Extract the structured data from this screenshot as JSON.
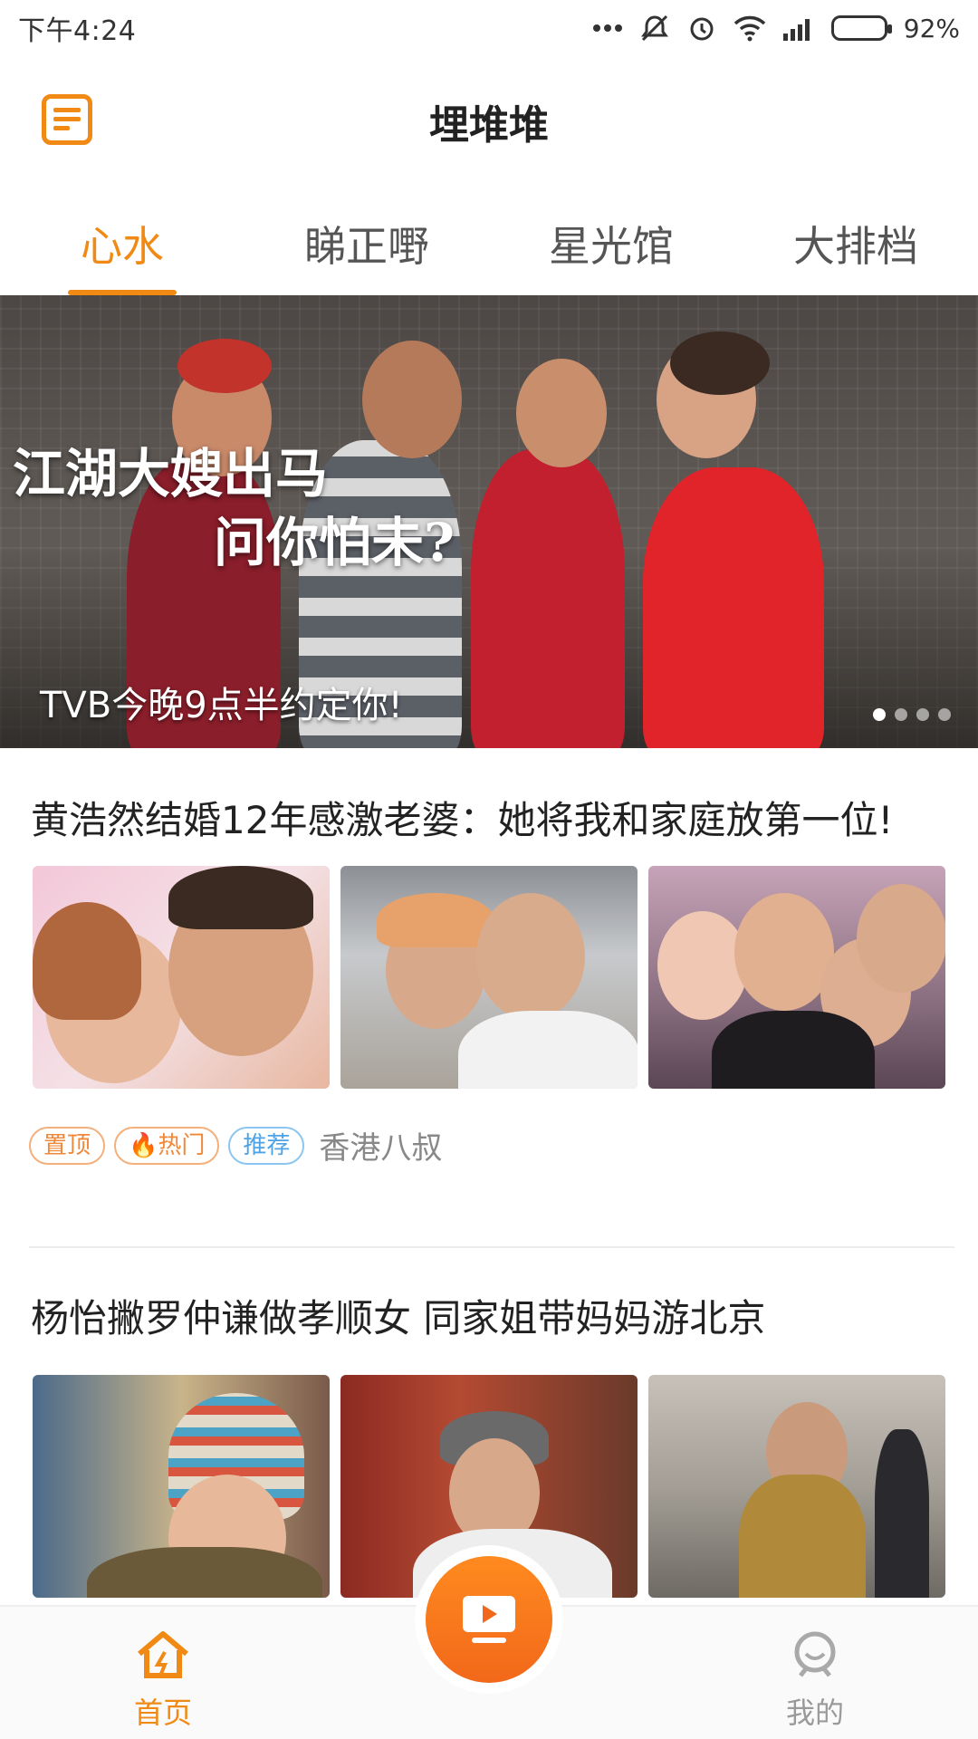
{
  "status_bar": {
    "time": "下午4:24",
    "battery": "92%",
    "battery_level": 0.92
  },
  "header": {
    "title": "埋堆堆",
    "menu_icon": "menu-list-icon"
  },
  "tabs": [
    {
      "label": "心水",
      "active": true
    },
    {
      "label": "睇正嘢",
      "active": false
    },
    {
      "label": "星光馆",
      "active": false
    },
    {
      "label": "大排档",
      "active": false
    }
  ],
  "banner": {
    "overlay_line1": "江湖大嫂出马",
    "overlay_line2": "问你怕未?",
    "caption": "TVB今晚9点半约定你!",
    "page_count": 4,
    "active_page": 1
  },
  "articles": [
    {
      "title": "黄浩然结婚12年感激老婆：她将我和家庭放第一位!",
      "tags": [
        "置顶",
        "热门",
        "推荐"
      ],
      "source": "香港八叔"
    },
    {
      "title": "杨怡撇罗仲谦做孝顺女 同家姐带妈妈游北京"
    }
  ],
  "bottom_nav": {
    "home_label": "首页",
    "me_label": "我的",
    "play_icon": "video-play-icon"
  },
  "colors": {
    "accent": "#f08a15",
    "tag_blue": "#4da3e6"
  }
}
